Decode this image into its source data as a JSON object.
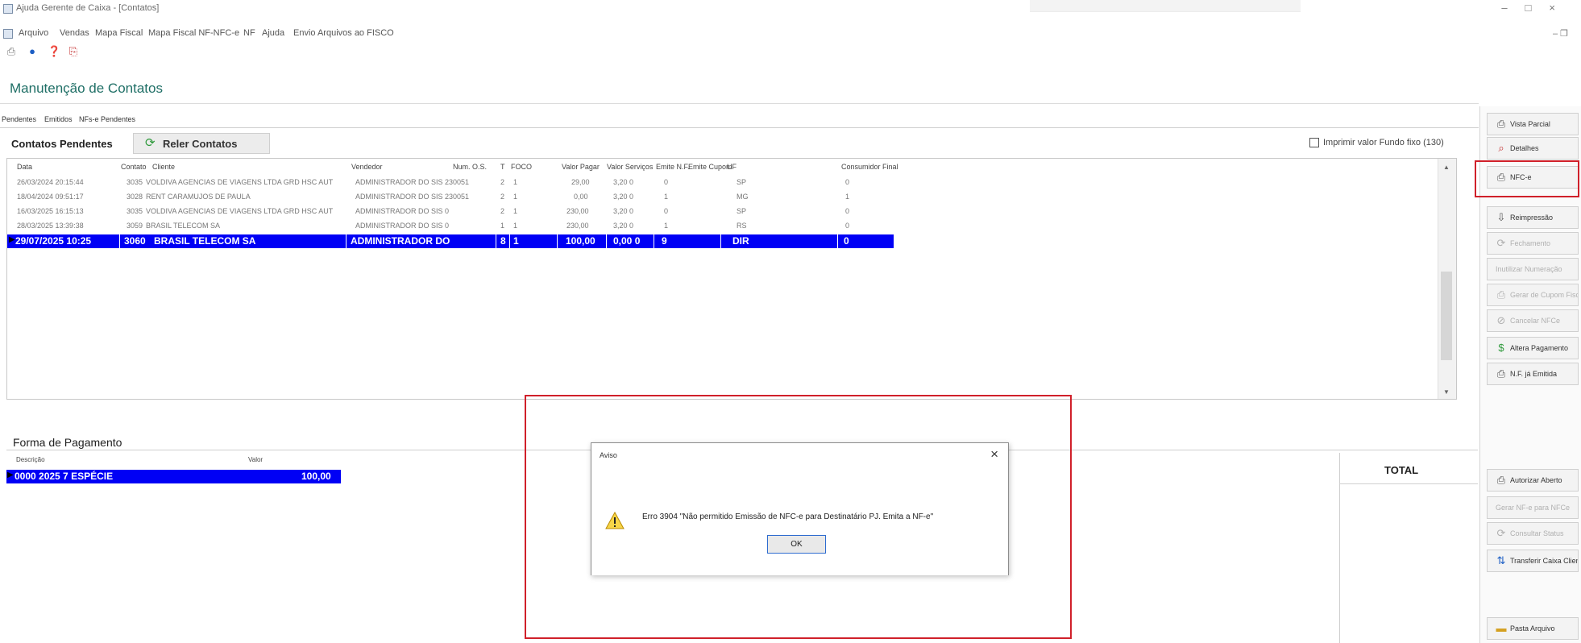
{
  "window": {
    "title": "Ajuda Gerente de Caixa - [Contatos]",
    "controls": [
      "–",
      "□",
      "×"
    ],
    "restore": "– ❐"
  },
  "menu": {
    "items": [
      "Arquivo",
      "Vendas",
      "Mapa Fiscal",
      "Mapa Fiscal NF-NFC-e",
      "NF",
      "Ajuda",
      "Envio Arquivos ao FISCO"
    ]
  },
  "toolbar": {
    "icons": [
      "save-icon",
      "circle-blue-icon",
      "help-icon",
      "pdf-icon"
    ]
  },
  "page": {
    "title": "Manutenção de Contatos"
  },
  "subtabs": [
    "Pendentes",
    "Emitidos",
    "NFs-e Pendentes"
  ],
  "pending": {
    "title": "Contatos Pendentes",
    "reload_label": "Reler Contatos",
    "print_label": "Imprimir valor Fundo fixo (130)"
  },
  "grid": {
    "columns": [
      "Data",
      "Contato",
      "Cliente",
      "Vendedor",
      "Num. O.S.",
      "T",
      "FOCO",
      "Valor Pagar",
      "Valor Serviços",
      "Emite N.F.",
      "Emite Cupom",
      "UF",
      "Consumidor Final"
    ],
    "rows": [
      [
        "26/03/2024 20:15:44",
        "3035",
        "VOLDIVA AGENCIAS DE VIAGENS LTDA GRD HSC AUT",
        "ADMINISTRADOR DO SIS 230051",
        "2",
        "1",
        "",
        "29,00",
        "3,20 0",
        "0",
        "SP",
        "0"
      ],
      [
        "18/04/2024 09:51:17",
        "3028",
        "RENT CARAMUJOS DE PAULA",
        "ADMINISTRADOR DO SIS 230051",
        "2",
        "1",
        "",
        "0,00",
        "3,20 0",
        "1",
        "MG",
        "1"
      ],
      [
        "16/03/2025 16:15:13",
        "3035",
        "VOLDIVA AGENCIAS DE VIAGENS LTDA GRD HSC AUT",
        "ADMINISTRADOR DO SIS 0",
        "2",
        "1",
        "",
        "230,00",
        "3,20 0",
        "0",
        "SP",
        "0"
      ],
      [
        "28/03/2025 13:39:38",
        "3059",
        "BRASIL TELECOM SA",
        "ADMINISTRADOR DO SIS 0",
        "1",
        "1",
        "",
        "230,00",
        "3,20 0",
        "1",
        "RS",
        "0"
      ],
      [
        "29/07/2025 10:25",
        "3060",
        "BRASIL TELECOM SA",
        "ADMINISTRADOR DO",
        "8",
        "1",
        "",
        "100,00",
        "0,00 0",
        "9",
        "DIR",
        "0"
      ]
    ]
  },
  "payment": {
    "title": "Forma de Pagamento",
    "columns": [
      "Descrição",
      "Valor"
    ],
    "row": [
      "0000 2025 7 ESPÉCIE",
      "100,00"
    ],
    "total_label": "TOTAL"
  },
  "right_panel": {
    "buttons": [
      {
        "label": "Vista Parcial",
        "icon": "printer-icon",
        "disabled": false
      },
      {
        "label": "Detalhes",
        "icon": "search-icon",
        "disabled": false
      },
      {
        "label": "NFC-e",
        "icon": "printer-icon",
        "disabled": false
      },
      {
        "label": "Reimpressão",
        "icon": "down-arrow-icon",
        "disabled": false
      },
      {
        "label": "Fechamento",
        "icon": "refresh-icon",
        "disabled": true
      },
      {
        "label": "Inutilizar Numeração",
        "icon": "blank-icon",
        "disabled": true
      },
      {
        "label": "Gerar de Cupom Fiscal",
        "icon": "printer-icon",
        "disabled": true
      },
      {
        "label": "Cancelar NFCe",
        "icon": "cancel-icon",
        "disabled": true
      },
      {
        "label": "Altera Pagamento",
        "icon": "money-icon",
        "disabled": false
      },
      {
        "label": "N.F. já Emitida",
        "icon": "printer-icon",
        "disabled": false
      },
      {
        "label": "Autorizar Aberto",
        "icon": "printer-icon",
        "disabled": false
      },
      {
        "label": "Gerar NF-e para NFCe",
        "icon": "blank-icon",
        "disabled": true
      },
      {
        "label": "Consultar Status",
        "icon": "refresh-icon",
        "disabled": true
      },
      {
        "label": "Transferir Caixa Cliente",
        "icon": "transfer-icon",
        "disabled": false
      },
      {
        "label": "Pasta Arquivo",
        "icon": "folder-icon",
        "disabled": false
      }
    ]
  },
  "dialog": {
    "title": "Aviso",
    "close": "×",
    "message": "Erro 3904 \"Não permitido Emissão de NFC-e para Destinatário PJ. Emita a NF-e\"",
    "ok_label": "OK"
  }
}
